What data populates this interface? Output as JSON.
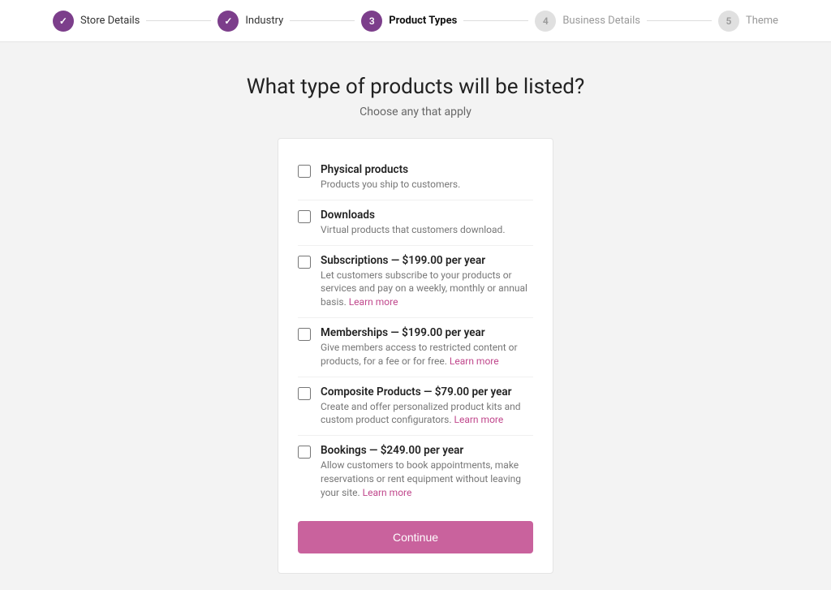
{
  "stepper": {
    "steps": [
      {
        "id": "store-details",
        "label": "Store Details",
        "number": "✓",
        "state": "completed"
      },
      {
        "id": "industry",
        "label": "Industry",
        "number": "✓",
        "state": "completed"
      },
      {
        "id": "product-types",
        "label": "Product Types",
        "number": "3",
        "state": "active"
      },
      {
        "id": "business-details",
        "label": "Business Details",
        "number": "4",
        "state": "inactive"
      },
      {
        "id": "theme",
        "label": "Theme",
        "number": "5",
        "state": "inactive"
      }
    ]
  },
  "page": {
    "title": "What type of products will be listed?",
    "subtitle": "Choose any that apply"
  },
  "products": [
    {
      "id": "physical",
      "title": "Physical products",
      "desc": "Products you ship to customers.",
      "learn_more": null
    },
    {
      "id": "downloads",
      "title": "Downloads",
      "desc": "Virtual products that customers download.",
      "learn_more": null
    },
    {
      "id": "subscriptions",
      "title": "Subscriptions — $199.00 per year",
      "desc": "Let customers subscribe to your products or services and pay on a weekly, monthly or annual basis.",
      "learn_more": "Learn more"
    },
    {
      "id": "memberships",
      "title": "Memberships — $199.00 per year",
      "desc": "Give members access to restricted content or products, for a fee or for free.",
      "learn_more": "Learn more"
    },
    {
      "id": "composite",
      "title": "Composite Products — $79.00 per year",
      "desc": "Create and offer personalized product kits and custom product configurators.",
      "learn_more": "Learn more"
    },
    {
      "id": "bookings",
      "title": "Bookings — $249.00 per year",
      "desc": "Allow customers to book appointments, make reservations or rent equipment without leaving your site.",
      "learn_more": "Learn more"
    }
  ],
  "buttons": {
    "continue": "Continue"
  }
}
